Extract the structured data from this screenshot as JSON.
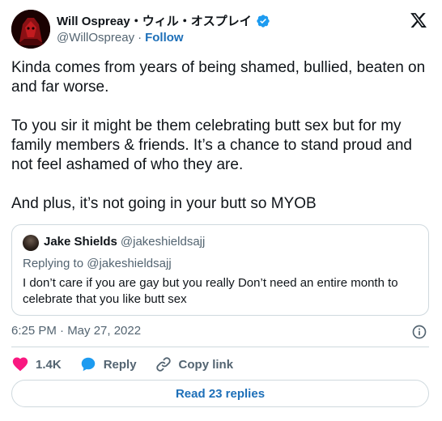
{
  "author": {
    "display_name": "Will Ospreay・ウィル・オスプレイ",
    "handle": "@WillOspreay",
    "follow_label": "Follow",
    "verified_icon": "verified-badge-icon"
  },
  "platform_logo": "x-logo-icon",
  "tweet": {
    "paragraphs": [
      "Kinda comes from years of being shamed, bullied, beaten on and far worse.",
      "To you sir it might be them celebrating butt sex but for my family members & friends. It’s a chance to stand proud and not feel ashamed of who they are.",
      "And plus, it’s not going in your butt so MYOB"
    ],
    "timestamp": "6:25 PM · May 27, 2022"
  },
  "quote": {
    "display_name": "Jake Shields",
    "handle": "@jakeshieldsajj",
    "replying_to": "Replying to @jakeshieldsajj",
    "text": "I don’t care if you are gay but you really Don’t need an entire month to celebrate that you like butt sex"
  },
  "actions": {
    "like_count": "1.4K",
    "reply_label": "Reply",
    "copy_link_label": "Copy link"
  },
  "read_replies_label": "Read 23 replies",
  "colors": {
    "link_blue": "#1d6fb8",
    "verified_blue": "#1d9bf0",
    "like_pink": "#f91880",
    "secondary_text": "#536471",
    "border": "#cfd9de"
  }
}
